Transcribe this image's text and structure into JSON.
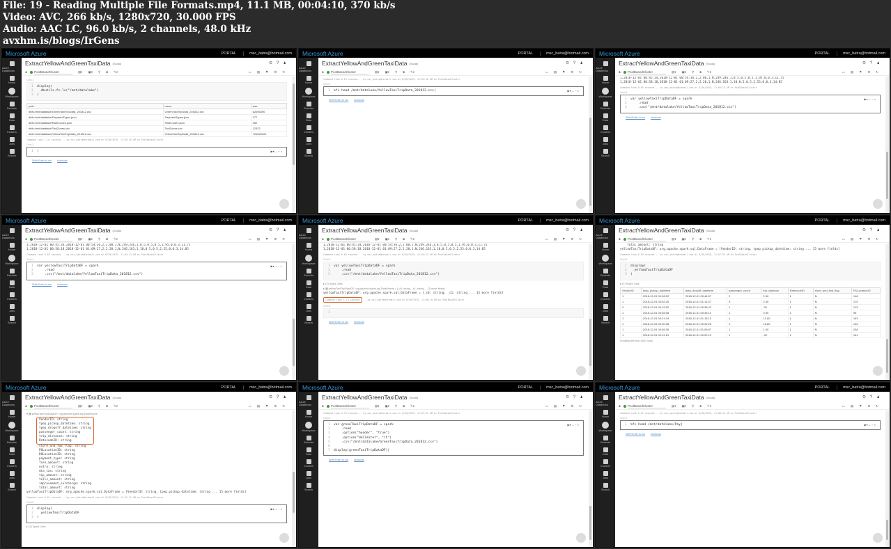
{
  "header": {
    "lines": [
      "File: 19 - Reading Multiple File Formats.mp4, 11.1 MB, 00:04:10, 370 kb/s",
      "Video: AVC, 266 kb/s, 1280x720, 30.000 FPS",
      "Audio: AAC LC, 96.0 kb/s, 2 channels, 48.0 kHz",
      "avxhm.is/blogs/IrGens"
    ]
  },
  "app": {
    "brand": "Microsoft Azure",
    "portal": "PORTAL",
    "email": "msc_batra@hotmail.com",
    "notebook_title": "ExtractYellowAndGreenTaxiData",
    "language": "(Scala)",
    "cluster": "PoolBasedCluster",
    "sidebar": [
      "Azure Databricks",
      "Home",
      "Workspace",
      "Recents",
      "Data",
      "Clusters",
      "Jobs",
      "Search"
    ],
    "shortcuts_hint": "Shift+Enter to run",
    "shortcuts_link": "shortcuts",
    "accent": "#3a9ad9",
    "highlight": "#d2692f"
  },
  "panels": [
    {
      "scroll": [
        0.05,
        0.6
      ],
      "items": [
        {
          "t": "label",
          "v": "Cmd 1"
        },
        {
          "t": "code",
          "lines": [
            "display(",
            "  dbutils.fs.ls(\"/mnt/datalake\")",
            ")"
          ]
        },
        {
          "t": "table",
          "headers": [
            "path",
            "name",
            "size"
          ],
          "rows": [
            [
              "dbfs:/mnt/datalake/GreenTaxiTripData_201812.csv",
              "GreenTaxiTripData_201812.csv",
              "62056490"
            ],
            [
              "dbfs:/mnt/datalake/PaymentTypes.json",
              "PaymentTypes.json",
              "277"
            ],
            [
              "dbfs:/mnt/datalake/RateCodes.json",
              "RateCodes.json",
              "252"
            ],
            [
              "dbfs:/mnt/datalake/TaxiZones.csv",
              "TaxiZones.csv",
              "12322"
            ],
            [
              "dbfs:/mnt/datalake/YellowTaxiTripData_201812.csv",
              "YellowTaxiTripData_201812.csv",
              "721522221"
            ]
          ]
        },
        {
          "t": "note",
          "v": "Command took 1.35 seconds -- by msc_batra@hotmail.com at 8/30/2019, 11:03:16 AM on PoolBasedCluster"
        },
        {
          "t": "label",
          "v": "Cmd 2"
        },
        {
          "t": "code",
          "active": true,
          "lines": [
            "|"
          ]
        },
        {
          "t": "shortcuts"
        }
      ]
    },
    {
      "scroll": [
        0.3,
        0.65
      ],
      "items": [
        {
          "t": "note",
          "v": "Command took 0.19 seconds -- by msc_batra@hotmail.com at 8/30/2019, 11:03:20 AM on PoolBasedCluster"
        },
        {
          "t": "label",
          "v": "Cmd 3"
        },
        {
          "t": "code",
          "active": true,
          "lines": [
            "%fs head /mnt/datalake/YellowTaxiTripData_201812.csv|"
          ]
        },
        {
          "t": "shortcuts"
        }
      ]
    },
    {
      "scroll": [
        0.55,
        0.35
      ],
      "items": [
        {
          "t": "out",
          "lines": [
            "1,2018-12-01 00:45:34,2018-12-01 00:54:36,2,2.00,1,N,249,246,1,8.5,0.5,0.5,1.95,0,0.3,11.75",
            "1,2018-12-01 00:58:18,2018-12-01 01:09:27,2,2.20,1,N,246,163,1,10,0.5,0.5,2.55,0,0.3,14.85"
          ]
        },
        {
          "t": "note",
          "v": "Command took 0.65 seconds -- by msc_batra@hotmail.com at 8/30/2019, 11:04:13 AM on PoolBasedCluster"
        },
        {
          "t": "label",
          "v": "Cmd 4"
        },
        {
          "t": "code",
          "active": true,
          "lines": [
            "var yellowTaxiTripDataDF = spark",
            "    .read",
            "    .csv(\"/mnt/datalake/YellowTaxiTripData_201812.csv\")"
          ]
        },
        {
          "t": "shortcuts"
        }
      ]
    },
    {
      "scroll": [
        0.55,
        0.35
      ],
      "items": [
        {
          "t": "out",
          "lines": [
            "1,2018-12-01 00:45:34,2018-12-01 00:54:36,2,2.00,1,N,249,246,1,8.5,0.5,0.5,1.95,0,0.3,11.75",
            "1,2018-12-01 00:58:18,2018-12-01 01:09:27,2,2.20,1,N,246,163,1,10,0.5,0.5,2.55,0,0.3,14.85"
          ]
        },
        {
          "t": "note",
          "v": "Command took 0.65 seconds -- by msc_batra@hotmail.com at 8/30/2019, 11:04:13 AM on PoolBasedCluster"
        },
        {
          "t": "label",
          "v": "Cmd 4"
        },
        {
          "t": "code",
          "active": true,
          "lines": [
            "var yellowTaxiTripDataDF = spark",
            "    .read",
            "    .csv(\"/mnt/datalake/YellowTaxiTripData_201812.csv\")"
          ]
        },
        {
          "t": "shortcuts"
        }
      ]
    },
    {
      "scroll": [
        0.55,
        0.35
      ],
      "items": [
        {
          "t": "out",
          "lines": [
            "1,2018-12-01 00:45:34,2018-12-01 00:54:36,2,2.00,1,N,249,246,1,8.5,0.5,0.5,1.95,0,0.3,11.75",
            "1,2018-12-01 00:58:18,2018-12-01 01:09:27,2,2.20,1,N,246,163,1,10,0.5,0.5,2.55,0,0.3,14.85"
          ]
        },
        {
          "t": "note",
          "v": "Command took 0.65 seconds -- by msc_batra@hotmail.com at 8/30/2019, 11:04:13 AM on PoolBasedCluster"
        },
        {
          "t": "label",
          "v": "Cmd 4"
        },
        {
          "t": "code",
          "lines": [
            "var yellowTaxiTripDataDF = spark",
            "    .read",
            "    .csv(\"/mnt/datalake/YellowTaxiTripData_201812.csv\")"
          ]
        },
        {
          "t": "jobs",
          "v": "▸ (1) Spark Jobs"
        },
        {
          "t": "jobs",
          "v": "▸ ▦ yellowTaxiTripDataDF: org.apache.spark.sql.DataFrame = [_c0: string, _c1: string ... 15 more fields]"
        },
        {
          "t": "out",
          "lines": [
            "yellowTaxiTripDataDF: org.apache.spark.sql.DataFrame = [_c0: string, _c1: string ... 15 more fields]"
          ]
        },
        {
          "t": "note",
          "hl": true,
          "v": "Command took 1.19 seconds",
          "rest": " -- by msc_batra@hotmail.com at 8/30/2019, 11:06:19 AM on PoolBasedCluster"
        },
        {
          "t": "label",
          "v": "Cmd 5"
        },
        {
          "t": "code",
          "lines": [
            " "
          ]
        },
        {
          "t": "shortcuts"
        }
      ]
    },
    {
      "scroll": [
        0.7,
        0.25
      ],
      "items": [
        {
          "t": "out",
          "lines": [
            "    total_amount: string",
            "yellowTaxiTripDataDF: org.apache.spark.sql.DataFrame = [VendorID: string, tpep_pickup_datetime: string ... 15 more fields]"
          ]
        },
        {
          "t": "note",
          "v": "Command took 0.63 seconds -- by msc_batra@hotmail.com at 8/30/2019, 11:07:29 AM on PoolBasedCluster"
        },
        {
          "t": "label",
          "v": "Cmd 5"
        },
        {
          "t": "code",
          "lines": [
            "display(",
            "  yellowTaxiTripDataDF",
            ")"
          ]
        },
        {
          "t": "jobs",
          "v": "▸ (1) Spark Jobs"
        },
        {
          "t": "table",
          "headers": [
            "VendorID",
            "tpep_pickup_datetime",
            "tpep_dropoff_datetime",
            "passenger_count",
            "trip_distance",
            "RatecodeID",
            "store_and_fwd_flag",
            "PULocationID"
          ],
          "rows": [
            [
              "1",
              "2018-12-01 00:28:22",
              "2018-12-01 00:44:07",
              "2",
              "2.50",
              "1",
              "N",
              "148"
            ],
            [
              "1",
              "2018-12-01 00:52:29",
              "2018-12-01 01:11:37",
              "3",
              "2.30",
              "1",
              "N",
              "170"
            ],
            [
              "2",
              "2018-12-01 00:12:52",
              "2018-12-01 00:36:23",
              "1",
              ".00",
              "1",
              "N",
              "113"
            ],
            [
              "1",
              "2018-12-01 00:35:08",
              "2018-12-01 00:43:11",
              "1",
              "3.90",
              "1",
              "N",
              "95"
            ],
            [
              "1",
              "2018-12-01 00:21:34",
              "2018-12-01 01:15:13",
              "1",
              "12.80",
              "1",
              "N",
              "163"
            ],
            [
              "1",
              "2018-12-01 00:00:38",
              "2018-12-01 00:29:26",
              "1",
              "18.80",
              "1",
              "N",
              "132"
            ],
            [
              "1",
              "2018-12-01 00:59:39",
              "2018-12-01 01:09:07",
              "1",
              "1.00",
              "1",
              "N",
              "246"
            ],
            [
              "1",
              "2018-12-01 00:19:19",
              "2018-12-01 00:22:19",
              "1",
              ".30",
              "1",
              "N",
              "161"
            ]
          ]
        },
        {
          "t": "jobs",
          "v": "Showing the first 1000 rows."
        }
      ]
    },
    {
      "scroll": [
        0.45,
        0.3
      ],
      "items": [
        {
          "t": "jobs",
          "v": "▾ ▦ yellowTaxiTripDataDF: org.apache.spark.sql.DataFrame"
        },
        {
          "t": "schema",
          "hl": [
            "VendorID: string",
            "tpep_pickup_datetime: string",
            "tpep_dropoff_datetime: string",
            "passenger_count: string",
            "trip_distance: string",
            "RatecodeID: string"
          ],
          "rest": [
            "store_and_fwd_flag: string",
            "PULocationID: string",
            "DOLocationID: string",
            "payment_type: string",
            "fare_amount: string",
            "extra: string",
            "mta_tax: string",
            "tip_amount: string",
            "tolls_amount: string",
            "improvement_surcharge: string",
            "total_amount: string"
          ]
        },
        {
          "t": "out",
          "lines": [
            "yellowTaxiTripDataDF: org.apache.spark.sql.DataFrame = [VendorID: string, tpep_pickup_datetime: string ... 15 more fields]"
          ]
        },
        {
          "t": "note",
          "v": "Command took 0.61 seconds -- by msc_batra@hotmail.com at 8/30/2019, 11:07:12 AM on PoolBasedCluster"
        },
        {
          "t": "label",
          "v": "Cmd 5"
        },
        {
          "t": "code",
          "active": true,
          "lines": [
            "display(",
            "  yellowTaxiTripDataDF",
            ")"
          ]
        },
        {
          "t": "jobs",
          "v": "▸ (1) Spark Jobs"
        }
      ]
    },
    {
      "scroll": [
        0.7,
        0.25
      ],
      "items": [
        {
          "t": "note",
          "v": "Command took 4.79 seconds -- by msc_batra@hotmail.com at 8/30/2019, 11:07:55 AM on PoolBasedCluster"
        },
        {
          "t": "label",
          "v": "Cmd 6"
        },
        {
          "t": "code",
          "active": true,
          "lines": [
            "var greenTaxiTripDataDF = spark",
            "    .read",
            "    .option(\"header\", \"true\")",
            "    .option(\"delimiter\", \"\\t\")",
            "    .csv(\"/mnt/datalake/GreenTaxiTripData_201812.csv\")",
            "",
            "display(greenTaxiTripDataDF)|"
          ]
        },
        {
          "t": "shortcuts"
        }
      ]
    },
    {
      "scroll": [
        0.8,
        0.15
      ],
      "items": [
        {
          "t": "note",
          "v": "Command took 1.67 seconds -- by msc_batra@hotmail.com at 8/30/2019, 11:08:54 AM on PoolBasedCluster"
        },
        {
          "t": "label",
          "v": "Cmd 7"
        },
        {
          "t": "code",
          "active": true,
          "lines": [
            "%fs head /mnt/datalake/Pay|"
          ]
        },
        {
          "t": "shortcuts"
        }
      ]
    }
  ]
}
